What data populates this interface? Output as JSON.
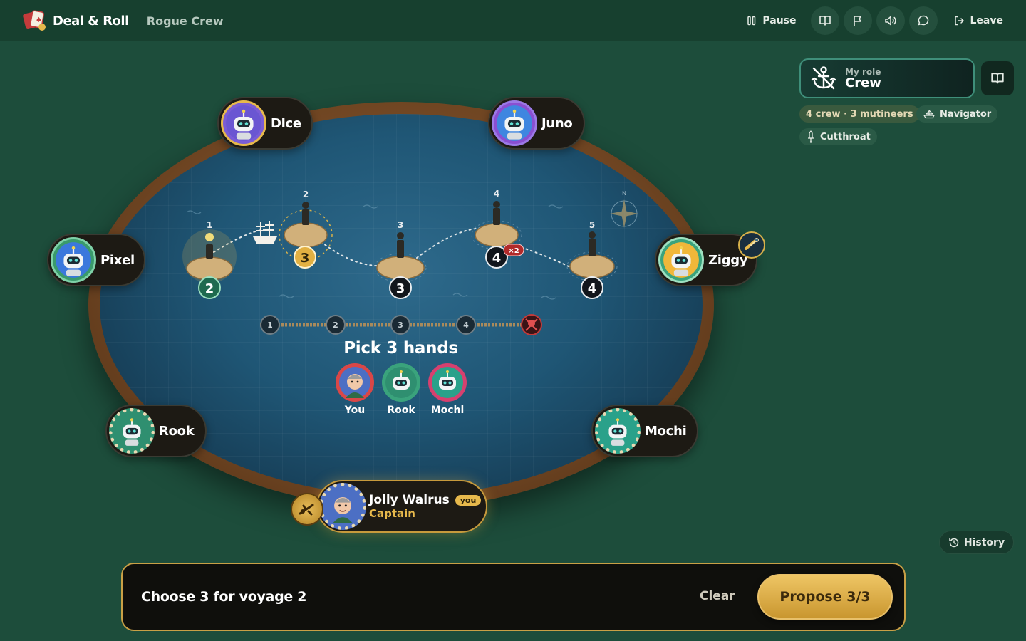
{
  "header": {
    "app_name": "Deal & Roll",
    "game_name": "Rogue Crew",
    "pause_label": "Pause",
    "leave_label": "Leave"
  },
  "role": {
    "caption": "My role",
    "name": "Crew",
    "composition": "4 crew · 3 mutineers",
    "chips": [
      "Navigator",
      "Cutthroat"
    ]
  },
  "players": {
    "dice": "Dice",
    "juno": "Juno",
    "pixel": "Pixel",
    "ziggy": "Ziggy",
    "rook": "Rook",
    "mochi": "Mochi",
    "me": {
      "name": "Jolly Walrus",
      "tag": "you",
      "role": "Captain"
    }
  },
  "voyage_map": {
    "islands": [
      {
        "number": "1",
        "crew_needed": "2",
        "state": "current"
      },
      {
        "number": "2",
        "crew_needed": "3",
        "state": "success"
      },
      {
        "number": "3",
        "crew_needed": "3",
        "state": "pending"
      },
      {
        "number": "4",
        "crew_needed": "4",
        "state": "pending",
        "modifier": "×2"
      },
      {
        "number": "5",
        "crew_needed": "4",
        "state": "pending"
      }
    ],
    "compass_label": "N",
    "track_steps": [
      "1",
      "2",
      "3",
      "4"
    ],
    "track_end": "skull"
  },
  "pick": {
    "title": "Pick 3 hands",
    "selected": [
      {
        "label": "You",
        "color": "#d94747"
      },
      {
        "label": "Rook",
        "color": "#3aa37c"
      },
      {
        "label": "Mochi",
        "color": "#d6406f"
      }
    ]
  },
  "history_label": "History",
  "action_bar": {
    "instruction": "Choose 3 for voyage 2",
    "clear_label": "Clear",
    "propose_label": "Propose 3/3"
  },
  "colors": {
    "background": "#1d4d3b",
    "accent_gold": "#e7b94c",
    "sea": "#1f5675",
    "rim": "#6f4522"
  }
}
